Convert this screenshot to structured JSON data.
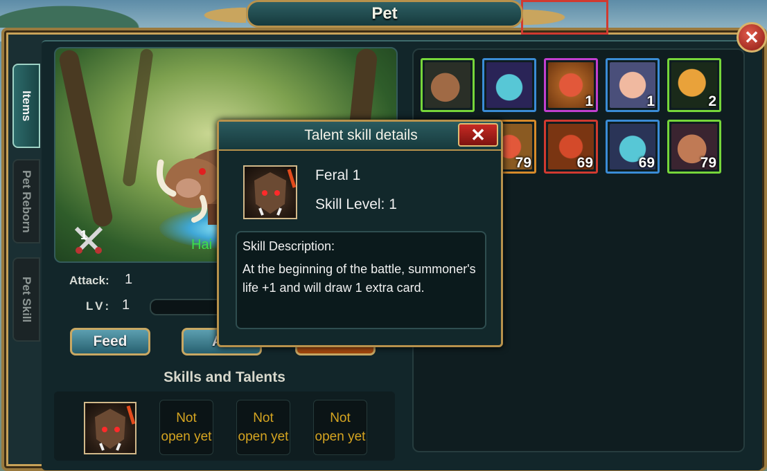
{
  "window": {
    "title": "Pet",
    "close_icon": "close-icon"
  },
  "tabs": [
    {
      "label": "Items",
      "active": true
    },
    {
      "label": "Pet Reborn",
      "active": false
    },
    {
      "label": "Pet Skill",
      "active": false
    }
  ],
  "pet": {
    "name": "Hai",
    "badge_value": "1",
    "attack_label": "Attack:",
    "attack_value": "1",
    "level_label": "LV:",
    "level_value": "1"
  },
  "buttons": {
    "feed": "Feed",
    "ability": "Ab",
    "orange": ""
  },
  "skills": {
    "title": "Skills and Talents",
    "slots": [
      "Not open yet",
      "Not open yet",
      "Not open yet"
    ]
  },
  "inventory": {
    "items": [
      {
        "icon": "boar-icon",
        "rarity": "green",
        "count": ""
      },
      {
        "icon": "dragon-icon",
        "rarity": "blue",
        "count": ""
      },
      {
        "icon": "shrimp-icon",
        "rarity": "purple",
        "count": "1"
      },
      {
        "icon": "meat-icon",
        "rarity": "blue",
        "count": "1"
      },
      {
        "icon": "bread-icon",
        "rarity": "green",
        "count": "2"
      },
      {
        "icon": "shrimp-icon",
        "rarity": "orange",
        "count": "79"
      },
      {
        "icon": "shrimp-icon",
        "rarity": "red",
        "count": "69"
      },
      {
        "icon": "dragon-icon",
        "rarity": "blue",
        "count": "69"
      },
      {
        "icon": "boar-icon",
        "rarity": "green",
        "count": "79"
      }
    ]
  },
  "popup": {
    "title": "Talent skill details",
    "skill_name": "Feral 1",
    "skill_level": "Skill Level: 1",
    "desc_title": "Skill Description:",
    "desc_text": "At the beginning of the battle, summoner's life +1 and will draw 1 extra card."
  }
}
